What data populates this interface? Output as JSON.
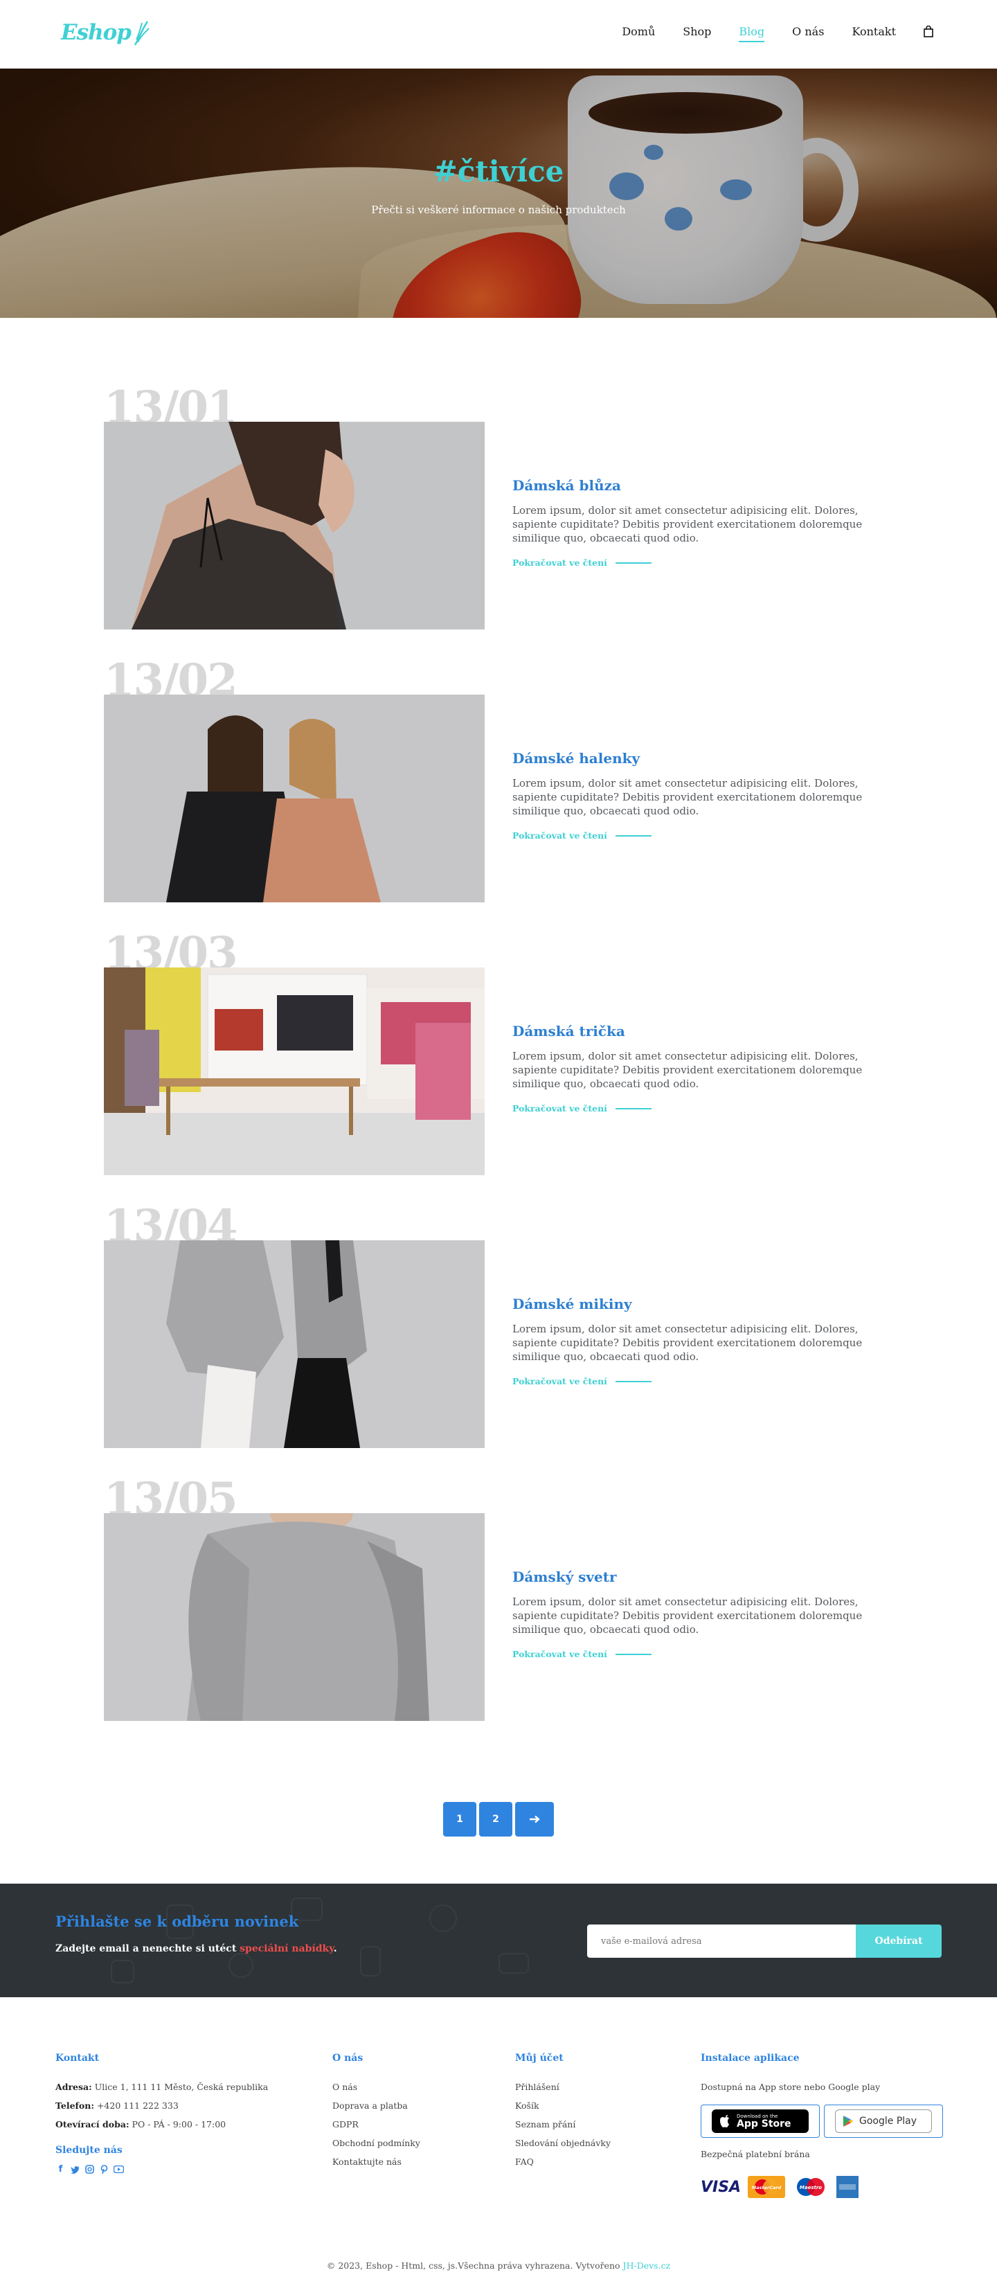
{
  "header": {
    "logo": "Eshop",
    "nav": [
      "Domů",
      "Shop",
      "Blog",
      "O nás",
      "Kontakt"
    ],
    "active_nav": "Blog",
    "cart_icon": "shopping-bag-icon"
  },
  "hero": {
    "title": "#čtivíce",
    "subtitle": "Přečti si veškeré informace o našich produktech"
  },
  "posts": [
    {
      "date": "13/01",
      "title": "Dámská blůza",
      "excerpt": "Lorem ipsum, dolor sit amet consectetur adipisicing elit. Dolores, sapiente cupiditate? Debitis provident exercitationem doloremque similique quo, obcaecati quod odio.",
      "more": "Pokračovat ve čtení"
    },
    {
      "date": "13/02",
      "title": "Dámské halenky",
      "excerpt": "Lorem ipsum, dolor sit amet consectetur adipisicing elit. Dolores, sapiente cupiditate? Debitis provident exercitationem doloremque similique quo, obcaecati quod odio.",
      "more": "Pokračovat ve čtení"
    },
    {
      "date": "13/03",
      "title": "Dámská trička",
      "excerpt": "Lorem ipsum, dolor sit amet consectetur adipisicing elit. Dolores, sapiente cupiditate? Debitis provident exercitationem doloremque similique quo, obcaecati quod odio.",
      "more": "Pokračovat ve čtení"
    },
    {
      "date": "13/04",
      "title": "Dámské mikiny",
      "excerpt": "Lorem ipsum, dolor sit amet consectetur adipisicing elit. Dolores, sapiente cupiditate? Debitis provident exercitationem doloremque similique quo, obcaecati quod odio.",
      "more": "Pokračovat ve čtení"
    },
    {
      "date": "13/05",
      "title": "Dámský svetr",
      "excerpt": "Lorem ipsum, dolor sit amet consectetur adipisicing elit. Dolores, sapiente cupiditate? Debitis provident exercitationem doloremque similique quo, obcaecati quod odio.",
      "more": "Pokračovat ve čtení"
    }
  ],
  "pagination": {
    "pages": [
      "1",
      "2"
    ],
    "next_icon": "arrow-right-icon"
  },
  "newsletter": {
    "title": "Přihlašte se k odběru novinek",
    "subtitle_start": "Zadejte email a nenechte si utéct ",
    "subtitle_highlight": "speciální nabídky",
    "subtitle_end": ".",
    "placeholder": "vaše e-mailová adresa",
    "button": "Odebírat"
  },
  "footer": {
    "contact": {
      "heading": "Kontakt",
      "address_label": "Adresa:",
      "address": "Ulice 1, 111 11 Město, Česká republika",
      "phone_label": "Telefon:",
      "phone": "+420 111 222 333",
      "hours_label": "Otevírací doba:",
      "hours": "PO - PÁ - 9:00 - 17:00",
      "follow": "Sledujte nás"
    },
    "about": {
      "heading": "O nás",
      "links": [
        "O nás",
        "Doprava a platba",
        "GDPR",
        "Obchodní podmínky",
        "Kontaktujte nás"
      ]
    },
    "account": {
      "heading": "Můj účet",
      "links": [
        "Přihlášení",
        "Košík",
        "Seznam přání",
        "Sledování objednávky",
        "FAQ"
      ]
    },
    "app": {
      "heading": "Instalace aplikace",
      "text": "Dostupná na App store nebo Google play",
      "appstore_small": "Download on the",
      "appstore_big": "App Store",
      "googleplay": "Google Play",
      "payment_label": "Bezpečná platební brána",
      "payment_visa": "VISA",
      "payment_mastercard": "MasterCard",
      "payment_maestro": "Maestro"
    },
    "copyright_text": "© 2023, Eshop - Html, css, js.Všechna práva vyhrazena. Vytvořeno ",
    "copyright_link": "JH-Devs.cz"
  },
  "colors": {
    "accent": "#3fd0d4",
    "primary": "#2f84e0",
    "dark": "#2d3336",
    "highlight": "#ef4d4d"
  }
}
